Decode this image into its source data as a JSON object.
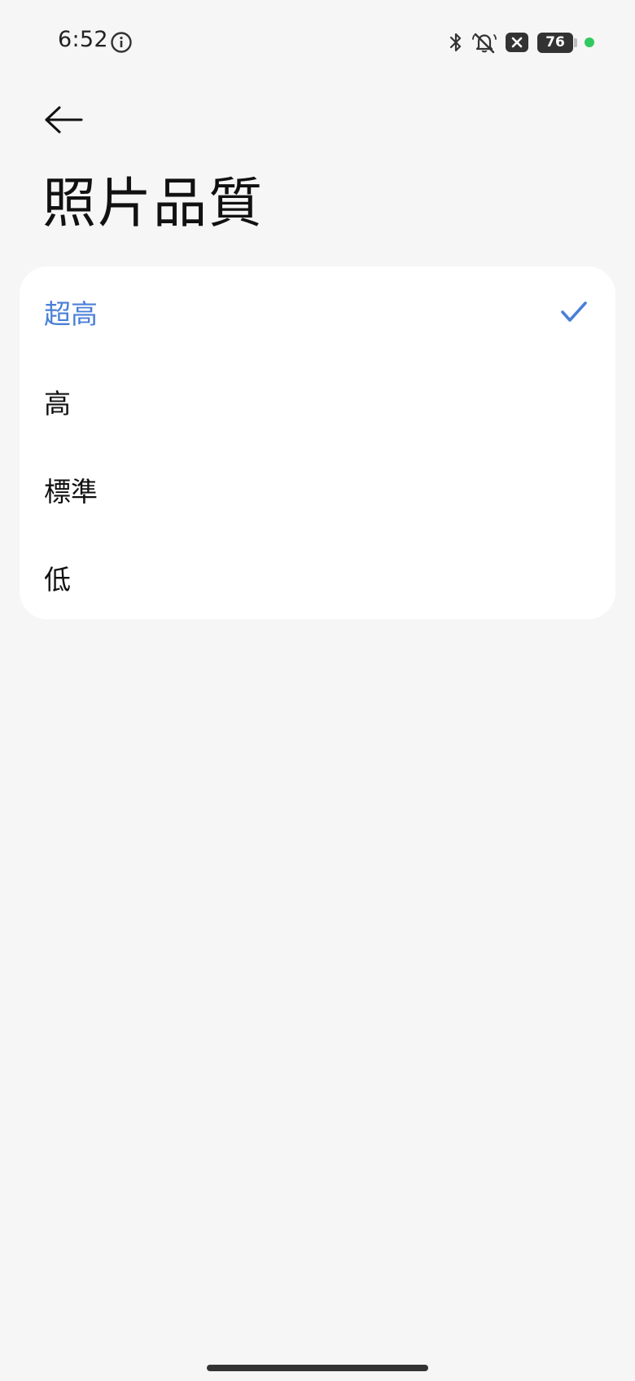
{
  "status_bar": {
    "time": "6:52",
    "battery_level": "76",
    "icons": [
      "info-icon",
      "bluetooth-icon",
      "bell-off-icon",
      "close-box-icon",
      "battery-icon",
      "active-dot"
    ]
  },
  "header": {
    "back_icon": "arrow-left-icon",
    "title": "照片品質"
  },
  "options": [
    {
      "label": "超高",
      "selected": true
    },
    {
      "label": "高",
      "selected": false
    },
    {
      "label": "標準",
      "selected": false
    },
    {
      "label": "低",
      "selected": false
    }
  ],
  "colors": {
    "accent": "#4a7fd8",
    "background": "#f6f6f6",
    "card": "#ffffff",
    "status_dot": "#32c860"
  }
}
